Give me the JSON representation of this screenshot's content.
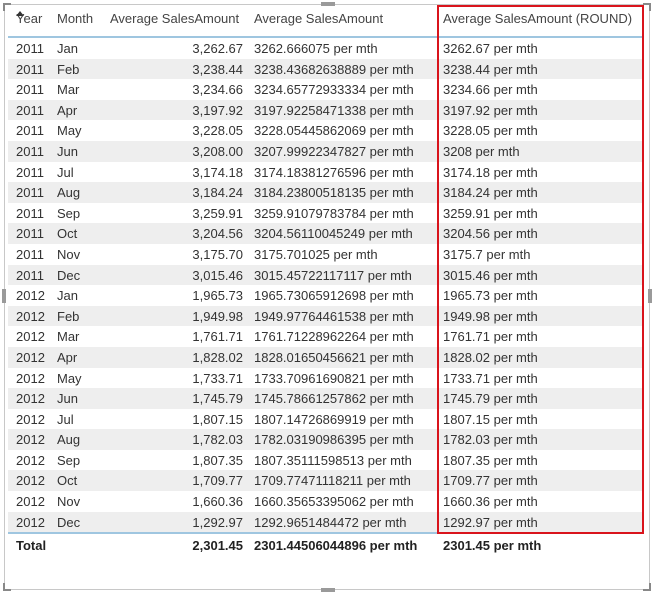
{
  "table": {
    "headers": [
      "Year",
      "Month",
      "Average SalesAmount",
      "Average SalesAmount",
      "Average SalesAmount (ROUND)"
    ],
    "sort_column": "Year",
    "highlight_color": "#d9141c",
    "rows": [
      [
        "2011",
        "Jan",
        "3,262.67",
        "3262.666075 per mth",
        "3262.67 per mth"
      ],
      [
        "2011",
        "Feb",
        "3,238.44",
        "3238.43682638889 per mth",
        "3238.44 per mth"
      ],
      [
        "2011",
        "Mar",
        "3,234.66",
        "3234.65772933334 per mth",
        "3234.66 per mth"
      ],
      [
        "2011",
        "Apr",
        "3,197.92",
        "3197.92258471338 per mth",
        "3197.92 per mth"
      ],
      [
        "2011",
        "May",
        "3,228.05",
        "3228.05445862069 per mth",
        "3228.05 per mth"
      ],
      [
        "2011",
        "Jun",
        "3,208.00",
        "3207.99922347827 per mth",
        "3208 per mth"
      ],
      [
        "2011",
        "Jul",
        "3,174.18",
        "3174.18381276596 per mth",
        "3174.18 per mth"
      ],
      [
        "2011",
        "Aug",
        "3,184.24",
        "3184.23800518135 per mth",
        "3184.24 per mth"
      ],
      [
        "2011",
        "Sep",
        "3,259.91",
        "3259.91079783784 per mth",
        "3259.91 per mth"
      ],
      [
        "2011",
        "Oct",
        "3,204.56",
        "3204.56110045249 per mth",
        "3204.56 per mth"
      ],
      [
        "2011",
        "Nov",
        "3,175.70",
        "3175.701025 per mth",
        "3175.7 per mth"
      ],
      [
        "2011",
        "Dec",
        "3,015.46",
        "3015.45722117117 per mth",
        "3015.46 per mth"
      ],
      [
        "2012",
        "Jan",
        "1,965.73",
        "1965.73065912698 per mth",
        "1965.73 per mth"
      ],
      [
        "2012",
        "Feb",
        "1,949.98",
        "1949.97764461538 per mth",
        "1949.98 per mth"
      ],
      [
        "2012",
        "Mar",
        "1,761.71",
        "1761.71228962264 per mth",
        "1761.71 per mth"
      ],
      [
        "2012",
        "Apr",
        "1,828.02",
        "1828.01650456621 per mth",
        "1828.02 per mth"
      ],
      [
        "2012",
        "May",
        "1,733.71",
        "1733.70961690821 per mth",
        "1733.71 per mth"
      ],
      [
        "2012",
        "Jun",
        "1,745.79",
        "1745.78661257862 per mth",
        "1745.79 per mth"
      ],
      [
        "2012",
        "Jul",
        "1,807.15",
        "1807.14726869919 per mth",
        "1807.15 per mth"
      ],
      [
        "2012",
        "Aug",
        "1,782.03",
        "1782.03190986395 per mth",
        "1782.03 per mth"
      ],
      [
        "2012",
        "Sep",
        "1,807.35",
        "1807.35111598513 per mth",
        "1807.35 per mth"
      ],
      [
        "2012",
        "Oct",
        "1,709.77",
        "1709.77471118211 per mth",
        "1709.77 per mth"
      ],
      [
        "2012",
        "Nov",
        "1,660.36",
        "1660.35653395062 per mth",
        "1660.36 per mth"
      ],
      [
        "2012",
        "Dec",
        "1,292.97",
        "1292.9651484472 per mth",
        "1292.97 per mth"
      ]
    ],
    "total": {
      "label": "Total",
      "avg": "2,301.45",
      "avg_text": "2301.44506044896 per mth",
      "avg_round": "2301.45 per mth"
    }
  }
}
